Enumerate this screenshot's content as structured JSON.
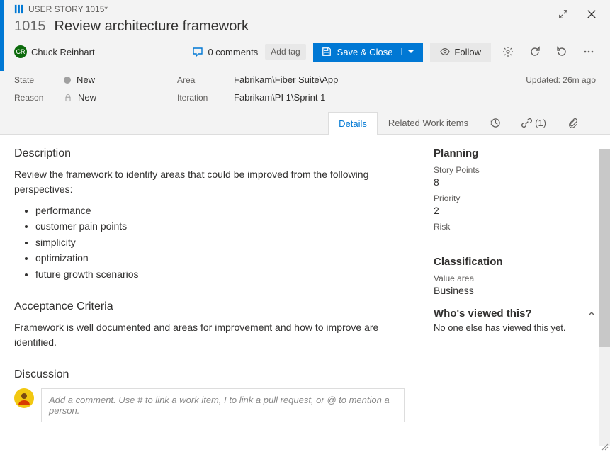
{
  "header": {
    "type_label": "USER STORY 1015*",
    "id": "1015",
    "title": "Review architecture framework"
  },
  "assignee": {
    "initials": "CR",
    "name": "Chuck Reinhart"
  },
  "actions": {
    "comments_count": "0 comments",
    "add_tag": "Add tag",
    "save": "Save & Close",
    "follow": "Follow"
  },
  "meta": {
    "state_label": "State",
    "state_value": "New",
    "reason_label": "Reason",
    "reason_value": "New",
    "area_label": "Area",
    "area_value": "Fabrikam\\Fiber Suite\\App",
    "iteration_label": "Iteration",
    "iteration_value": "Fabrikam\\PI 1\\Sprint 1",
    "updated": "Updated: 26m ago"
  },
  "tabs": {
    "details": "Details",
    "related": "Related Work items",
    "links_count": "(1)"
  },
  "description": {
    "heading": "Description",
    "intro": "Review the framework to identify areas that could be improved from the following perspectives:",
    "bullets": [
      "performance",
      "customer pain points",
      "simplicity",
      "optimization",
      "future growth scenarios"
    ]
  },
  "acceptance": {
    "heading": "Acceptance Criteria",
    "text": "Framework is well documented and areas for improvement and how to improve are identified."
  },
  "discussion": {
    "heading": "Discussion",
    "placeholder": "Add a comment. Use # to link a work item, ! to link a pull request, or @ to mention a person."
  },
  "planning": {
    "heading": "Planning",
    "story_points_label": "Story Points",
    "story_points": "8",
    "priority_label": "Priority",
    "priority": "2",
    "risk_label": "Risk"
  },
  "classification": {
    "heading": "Classification",
    "value_area_label": "Value area",
    "value_area": "Business"
  },
  "viewed": {
    "heading": "Who's viewed this?",
    "text": "No one else has viewed this yet."
  }
}
